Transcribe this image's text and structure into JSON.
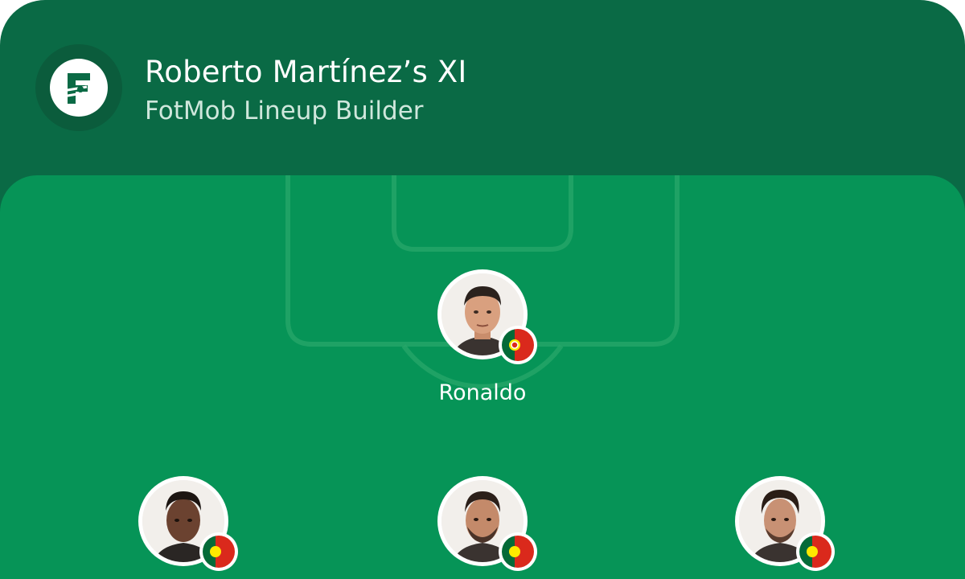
{
  "header": {
    "title": "Roberto Martínez’s XI",
    "subtitle": "FotMob Lineup Builder",
    "logo_icon": "fotmob-logo-icon"
  },
  "colors": {
    "header_bg": "#0a6a45",
    "pitch_bg": "#069457",
    "text": "#ffffff",
    "subtitle_text": "#cfe7dc"
  },
  "players": [
    {
      "name": "Ronaldo",
      "nation_flag": "portugal-flag-icon"
    },
    {
      "name": "",
      "nation_flag": "portugal-flag-icon"
    },
    {
      "name": "",
      "nation_flag": "portugal-flag-icon"
    },
    {
      "name": "",
      "nation_flag": "portugal-flag-icon"
    }
  ]
}
